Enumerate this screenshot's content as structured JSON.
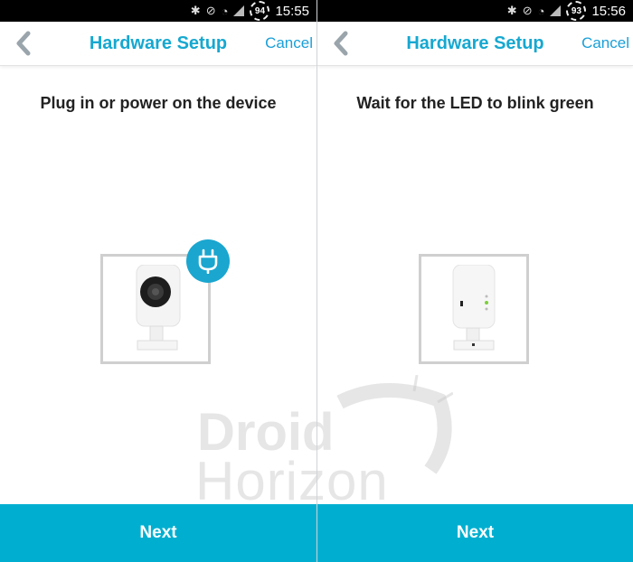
{
  "screens": [
    {
      "status": {
        "battery": "94",
        "time": "15:55"
      },
      "appbar": {
        "title": "Hardware Setup",
        "cancel_label": "Cancel"
      },
      "instruction": "Plug in or power on the device",
      "image": {
        "subject": "camera-front",
        "badge_icon": "plug-icon"
      },
      "next_label": "Next"
    },
    {
      "status": {
        "battery": "93",
        "time": "15:56"
      },
      "appbar": {
        "title": "Hardware Setup",
        "cancel_label": "Cancel"
      },
      "instruction": "Wait for the LED to blink green",
      "image": {
        "subject": "camera-back"
      },
      "next_label": "Next"
    }
  ],
  "watermark": {
    "line1": "Droid",
    "line2": "Horizon"
  },
  "colors": {
    "accent": "#16a8d0",
    "button": "#00afd0",
    "led_green": "#7ccf3a"
  }
}
